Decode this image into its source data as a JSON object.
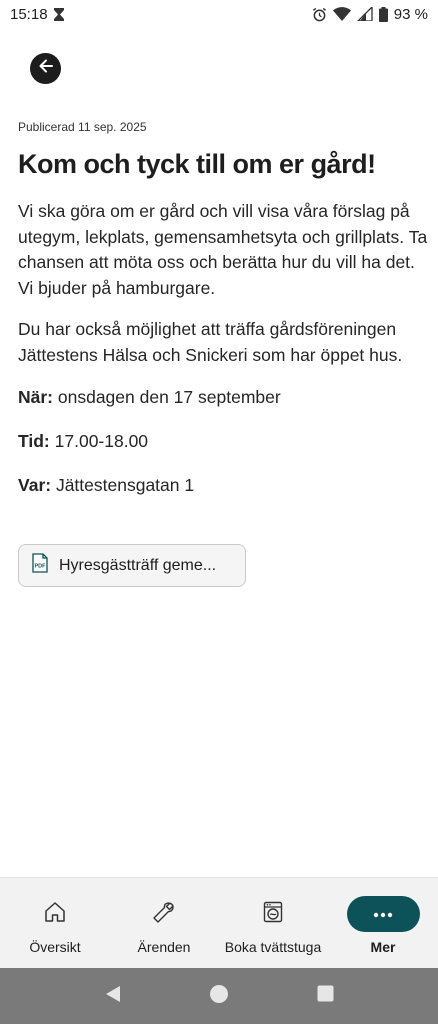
{
  "status_bar": {
    "time": "15:18",
    "battery": "93 %"
  },
  "article": {
    "published": "Publicerad 11 sep. 2025",
    "title": "Kom och tyck till om er gård!",
    "paragraphs": [
      "Vi ska göra om er gård och vill visa våra förslag på utegym, lekplats, gemensamhetsyta och grillplats. Ta chansen att möta oss och berätta hur du vill ha det. Vi bjuder på hamburgare.",
      "Du har också möjlighet att träffa gårdsföreningen Jättestens Hälsa och Snickeri som har öppet hus."
    ],
    "when_label": "När:",
    "when_value": " onsdagen den 17 september",
    "time_label": "Tid:",
    "time_value": " 17.00-18.00",
    "where_label": "Var:",
    "where_value": " Jättestensgatan 1"
  },
  "attachment": {
    "label": "Hyresgästträff geme...",
    "icon": "pdf-icon"
  },
  "bottom_nav": {
    "items": [
      {
        "label": "Översikt",
        "icon": "home-icon"
      },
      {
        "label": "Ärenden",
        "icon": "wrench-icon"
      },
      {
        "label": "Boka tvättstuga",
        "icon": "washing-machine-icon"
      },
      {
        "label": "Mer",
        "icon": "more-icon",
        "active": true
      }
    ]
  },
  "colors": {
    "accent": "#0c5258",
    "back_button": "#1c1c1c"
  }
}
